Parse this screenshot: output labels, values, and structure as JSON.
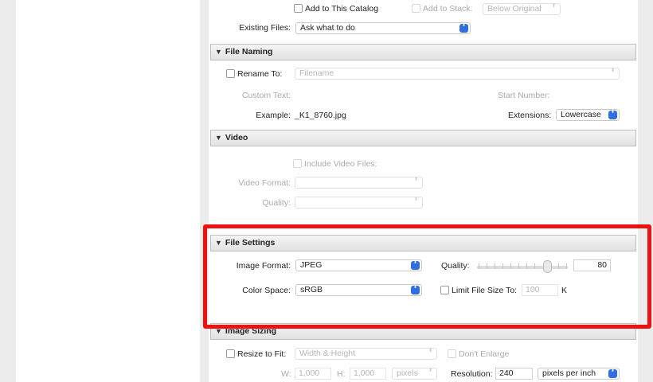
{
  "import_catalog": {
    "add_to_catalog_label": "Add to This Catalog",
    "add_to_stack_label": "Add to Stack:",
    "stack_position_value": "Below Original",
    "existing_files_label": "Existing Files:",
    "existing_files_value": "Ask what to do"
  },
  "file_naming": {
    "header": "File Naming",
    "rename_to_label": "Rename To:",
    "rename_to_value": "Filename",
    "custom_text_label": "Custom Text:",
    "start_number_label": "Start Number:",
    "example_label": "Example:",
    "example_value": "_K1_8760.jpg",
    "extensions_label": "Extensions:",
    "extensions_value": "Lowercase"
  },
  "video": {
    "header": "Video",
    "include_video_label": "Include Video Files:",
    "video_format_label": "Video Format:",
    "quality_label": "Quality:"
  },
  "file_settings": {
    "header": "File Settings",
    "image_format_label": "Image Format:",
    "image_format_value": "JPEG",
    "quality_label": "Quality:",
    "quality_value": "80",
    "color_space_label": "Color Space:",
    "color_space_value": "sRGB",
    "limit_size_label": "Limit File Size To:",
    "limit_size_value": "100",
    "limit_size_unit": "K"
  },
  "image_sizing": {
    "header": "Image Sizing",
    "resize_label": "Resize to Fit:",
    "resize_value": "Width & Height",
    "dont_enlarge_label": "Don't Enlarge",
    "w_label": "W:",
    "w_value": "1,000",
    "h_label": "H:",
    "h_value": "1,000",
    "units_value": "pixels",
    "resolution_label": "Resolution:",
    "resolution_value": "240",
    "resolution_units_value": "pixels per inch"
  },
  "colors": {
    "highlight": "#ee1111",
    "accent": "#2f6fe0"
  },
  "icons": {
    "disclosure": "disclosure-triangle-icon",
    "select_arrows": "chevron-up-down-icon"
  },
  "glyphs": {
    "triangle": "▼",
    "updown": "⬍"
  }
}
